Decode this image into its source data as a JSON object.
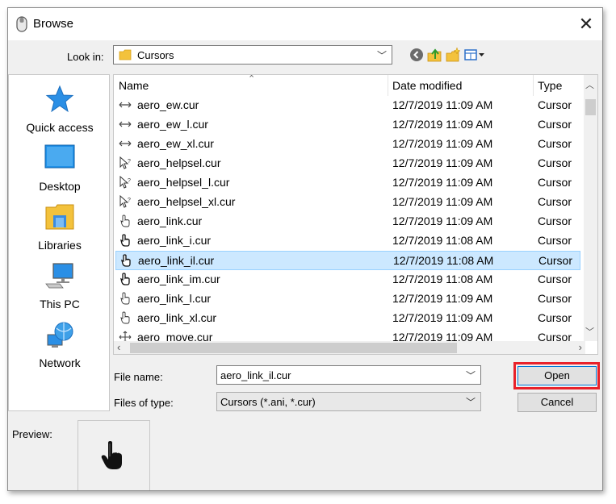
{
  "window": {
    "title": "Browse",
    "close_label": "✕"
  },
  "lookin": {
    "label": "Look in:",
    "value": "Cursors"
  },
  "toolbar": {
    "icons": [
      "back-icon",
      "up-folder-icon",
      "new-folder-icon",
      "view-menu-icon"
    ]
  },
  "places": [
    {
      "label": "Quick access",
      "icon": "star-icon"
    },
    {
      "label": "Desktop",
      "icon": "desktop-icon"
    },
    {
      "label": "Libraries",
      "icon": "libraries-icon"
    },
    {
      "label": "This PC",
      "icon": "computer-icon"
    },
    {
      "label": "Network",
      "icon": "network-icon"
    }
  ],
  "columns": {
    "name": "Name",
    "date": "Date modified",
    "type": "Type"
  },
  "files": [
    {
      "name": "aero_ew.cur",
      "date": "12/7/2019 11:09 AM",
      "type": "Cursor"
    },
    {
      "name": "aero_ew_l.cur",
      "date": "12/7/2019 11:09 AM",
      "type": "Cursor"
    },
    {
      "name": "aero_ew_xl.cur",
      "date": "12/7/2019 11:09 AM",
      "type": "Cursor"
    },
    {
      "name": "aero_helpsel.cur",
      "date": "12/7/2019 11:09 AM",
      "type": "Cursor"
    },
    {
      "name": "aero_helpsel_l.cur",
      "date": "12/7/2019 11:09 AM",
      "type": "Cursor"
    },
    {
      "name": "aero_helpsel_xl.cur",
      "date": "12/7/2019 11:09 AM",
      "type": "Cursor"
    },
    {
      "name": "aero_link.cur",
      "date": "12/7/2019 11:09 AM",
      "type": "Cursor"
    },
    {
      "name": "aero_link_i.cur",
      "date": "12/7/2019 11:08 AM",
      "type": "Cursor"
    },
    {
      "name": "aero_link_il.cur",
      "date": "12/7/2019 11:08 AM",
      "type": "Cursor"
    },
    {
      "name": "aero_link_im.cur",
      "date": "12/7/2019 11:08 AM",
      "type": "Cursor"
    },
    {
      "name": "aero_link_l.cur",
      "date": "12/7/2019 11:09 AM",
      "type": "Cursor"
    },
    {
      "name": "aero_link_xl.cur",
      "date": "12/7/2019 11:09 AM",
      "type": "Cursor"
    },
    {
      "name": "aero_move.cur",
      "date": "12/7/2019 11:09 AM",
      "type": "Cursor"
    }
  ],
  "selected_file": "aero_link_il.cur",
  "filename": {
    "label": "File name:",
    "value": "aero_link_il.cur"
  },
  "filetype": {
    "label": "Files of type:",
    "value": "Cursors (*.ani, *.cur)"
  },
  "buttons": {
    "open": "Open",
    "cancel": "Cancel"
  },
  "preview": {
    "label": "Preview:"
  },
  "colors": {
    "selection": "#cce8ff",
    "highlight": "#e8212a",
    "accent": "#0078d7"
  }
}
